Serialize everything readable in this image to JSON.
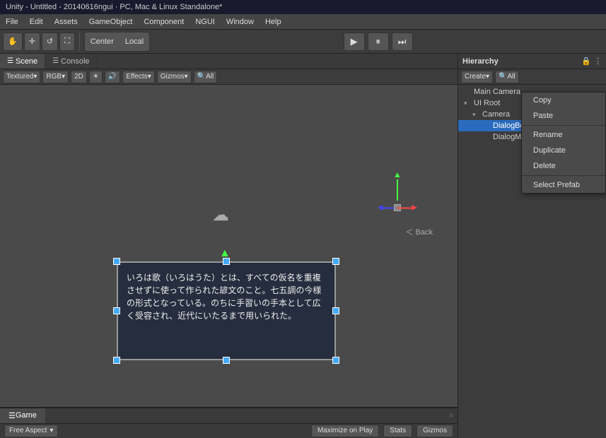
{
  "title_bar": {
    "text": "Unity - Untitled - 20140616ngui · PC, Mac & Linux Standalone*"
  },
  "menu_bar": {
    "items": [
      "File",
      "Edit",
      "Assets",
      "GameObject",
      "Component",
      "NGUI",
      "Window",
      "Help"
    ]
  },
  "toolbar": {
    "tools": [
      "✋",
      "✛",
      "↺",
      "⛶"
    ],
    "center_label": "Center",
    "local_label": "Local"
  },
  "scene_tab": {
    "tabs": [
      {
        "label": "Scene",
        "icon": "☰",
        "active": true
      },
      {
        "label": "Console",
        "icon": "☰",
        "active": false
      }
    ],
    "controls": {
      "textured_label": "Textured",
      "rgb_label": "RGB",
      "mode_2d": "2D",
      "lighting_icon": "☀",
      "audio_icon": "🔊",
      "effects_label": "Effects",
      "gizmos_label": "Gizmos",
      "all_label": "All"
    }
  },
  "hierarchy": {
    "title": "Hierarchy",
    "create_label": "Create",
    "search_placeholder": "All",
    "items": [
      {
        "label": "Main Camera",
        "indent": 0,
        "expanded": false,
        "selected": false
      },
      {
        "label": "UI Root",
        "indent": 0,
        "expanded": true,
        "selected": false
      },
      {
        "label": "Camera",
        "indent": 1,
        "expanded": true,
        "selected": false
      },
      {
        "label": "DialogBox",
        "indent": 2,
        "expanded": false,
        "selected": true
      },
      {
        "label": "DialogM...",
        "indent": 2,
        "expanded": false,
        "selected": false
      }
    ]
  },
  "context_menu": {
    "items": [
      {
        "label": "Copy",
        "separator_after": false
      },
      {
        "label": "Paste",
        "separator_after": true
      },
      {
        "label": "Rename",
        "separator_after": false
      },
      {
        "label": "Duplicate",
        "separator_after": false
      },
      {
        "label": "Delete",
        "separator_after": true
      },
      {
        "label": "Select Prefab",
        "separator_after": false
      }
    ]
  },
  "play_controls": {
    "play": "▶",
    "pause": "⏸",
    "step": "⏭"
  },
  "scene_viewport": {
    "dialog_text": "いろは歌（いろはうた）とは、すべての仮名を重複させずに使って作られた諺文のこと。七五調の今様の形式となっている。のちに手習いの手本として広く受容され、近代にいたるまで用いられた。",
    "back_label": "＜ Back"
  },
  "game_bar": {
    "tab_label": "Game",
    "aspect_label": "Free Aspect",
    "maximize_label": "Maximize on Play",
    "stats_label": "Stats",
    "gizmos_label": "Gizmos"
  }
}
